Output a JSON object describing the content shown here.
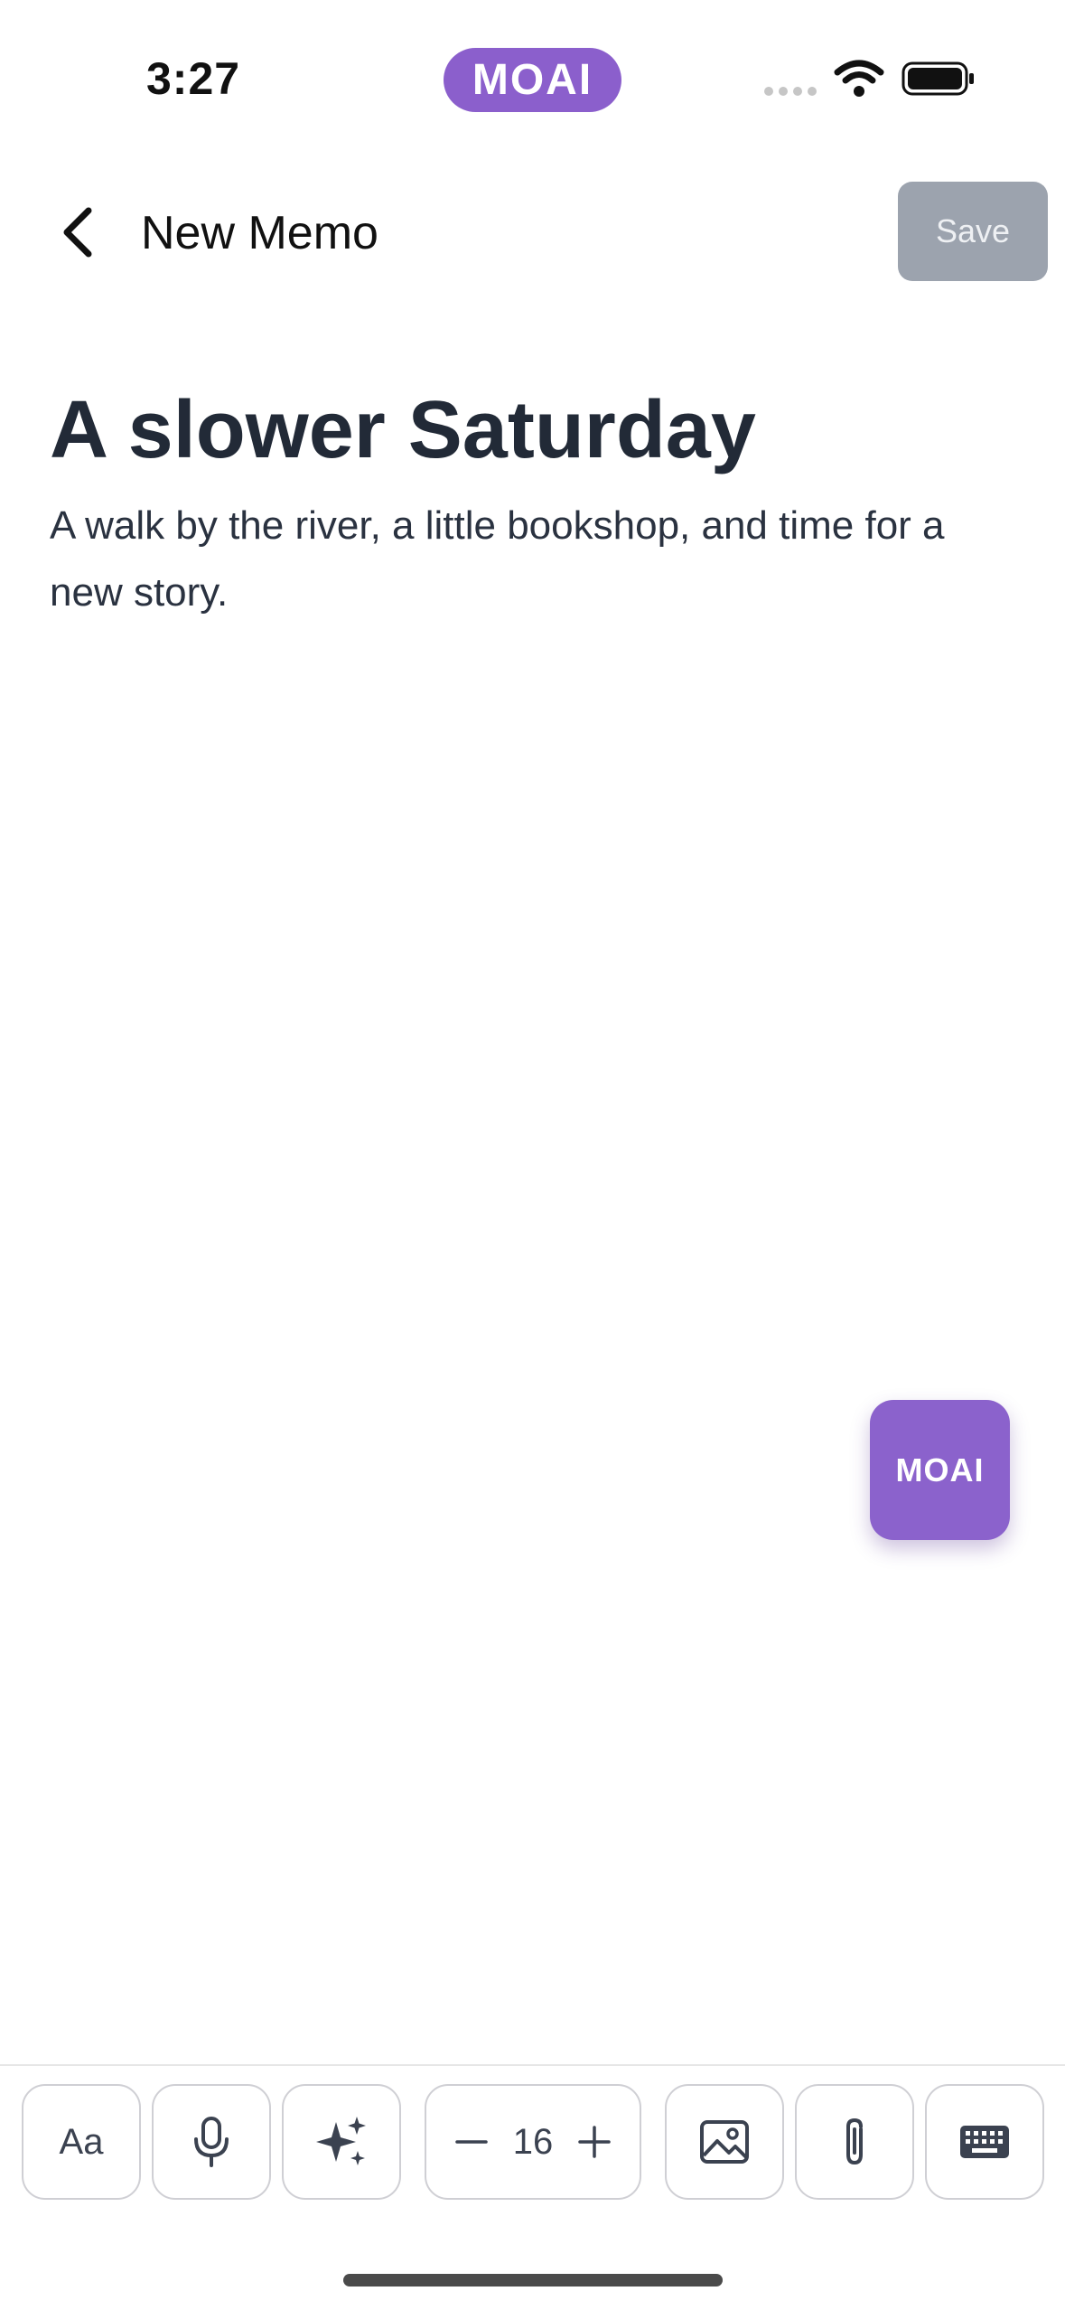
{
  "status_bar": {
    "time": "3:27",
    "island_label": "MOAI"
  },
  "nav": {
    "title": "New Memo",
    "save_label": "Save"
  },
  "memo": {
    "title": "A slower Saturday",
    "body": "A walk by the river, a little bookshop, and time for a new story."
  },
  "fab": {
    "label": "MOAI"
  },
  "toolbar": {
    "text_style_label": "Aa",
    "font_size": "16"
  },
  "colors": {
    "accent": "#8b62cc",
    "save_disabled": "#9ca3ae",
    "text": "#222a37"
  },
  "icons": [
    "chevron-left-icon",
    "wifi-icon",
    "battery-icon",
    "microphone-icon",
    "sparkles-icon",
    "minus-icon",
    "plus-icon",
    "image-icon",
    "paperclip-icon",
    "keyboard-icon"
  ]
}
